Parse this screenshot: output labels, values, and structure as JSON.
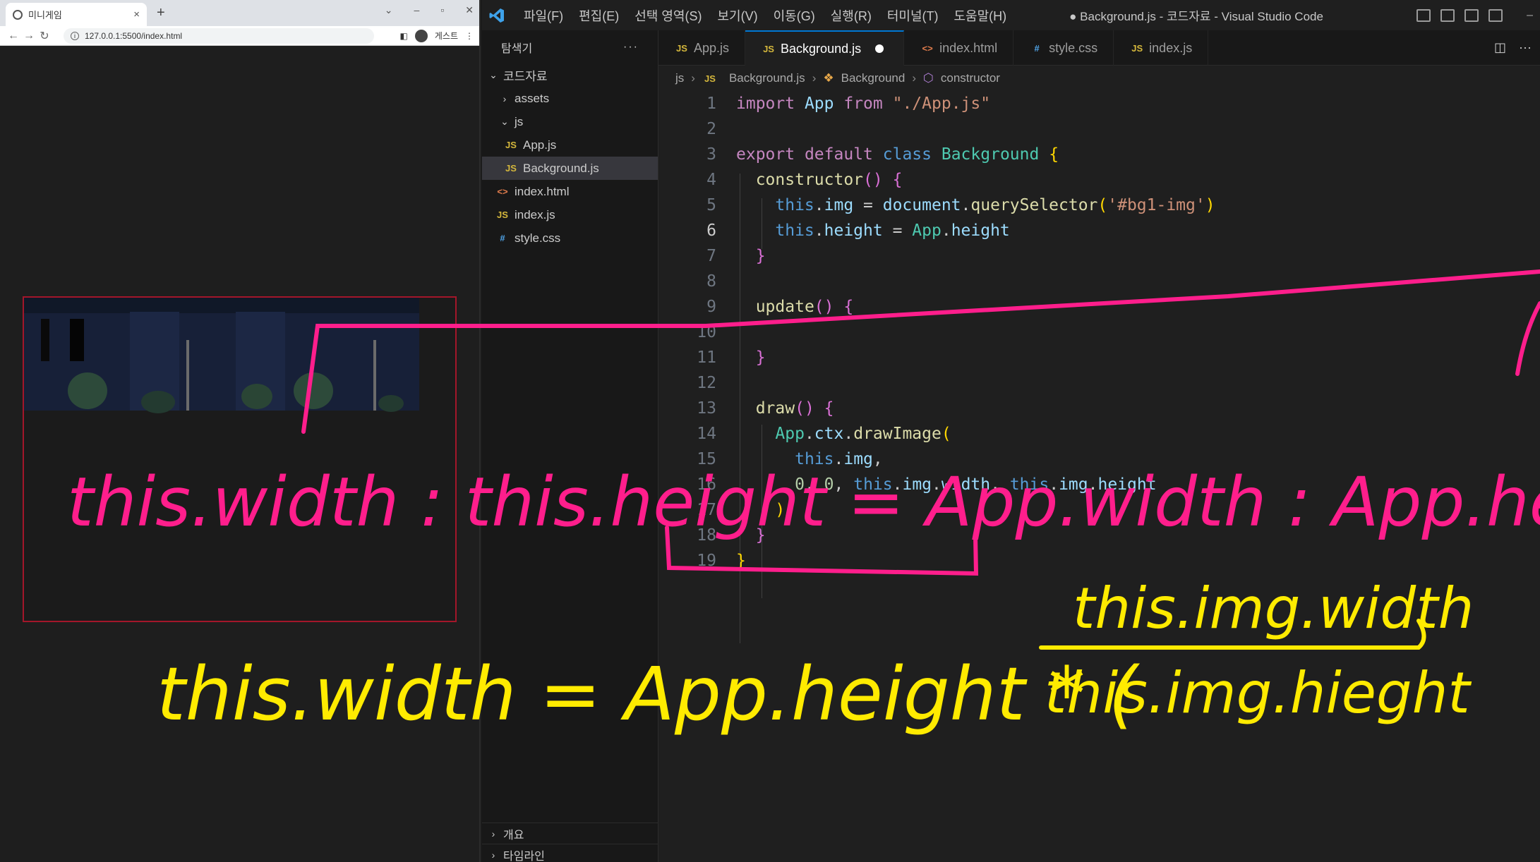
{
  "browser": {
    "tab_title": "미니게임",
    "url": "127.0.0.1:5500/index.html",
    "profile_label": "게스트"
  },
  "vscode": {
    "menu": [
      "파일(F)",
      "편집(E)",
      "선택 영역(S)",
      "보기(V)",
      "이동(G)",
      "실행(R)",
      "터미널(T)",
      "도움말(H)"
    ],
    "window_title": "● Background.js - 코드자료 - Visual Studio Code",
    "explorer": {
      "title": "탐색기",
      "more": "···",
      "root": "코드자료",
      "items": [
        {
          "label": "assets",
          "kind": "folder",
          "collapsed": true
        },
        {
          "label": "js",
          "kind": "folder",
          "collapsed": false
        },
        {
          "label": "App.js",
          "kind": "js"
        },
        {
          "label": "Background.js",
          "kind": "js",
          "selected": true
        },
        {
          "label": "index.html",
          "kind": "html"
        },
        {
          "label": "index.js",
          "kind": "js"
        },
        {
          "label": "style.css",
          "kind": "css"
        }
      ],
      "outline": "개요",
      "timeline": "타임라인"
    },
    "tabs": [
      {
        "label": "App.js",
        "icon": "JS"
      },
      {
        "label": "Background.js",
        "icon": "JS",
        "active": true,
        "modified": true
      },
      {
        "label": "index.html",
        "icon": "<>"
      },
      {
        "label": "style.css",
        "icon": "#"
      },
      {
        "label": "index.js",
        "icon": "JS"
      }
    ],
    "breadcrumb": [
      "js",
      "Background.js",
      "Background",
      "constructor"
    ],
    "line_numbers": [
      "1",
      "2",
      "3",
      "4",
      "5",
      "6",
      "7",
      "8",
      "9",
      "10",
      "11",
      "12",
      "13",
      "14",
      "15",
      "16",
      "17",
      "18",
      "19"
    ],
    "current_line": "6"
  },
  "annotations": {
    "pink_line1": "this.width : this.height = App.width : App.height",
    "yellow_line": "this.width = App.height * (",
    "yellow_fraction_top": "this.img.width",
    "yellow_fraction_bottom": "this.img.hieght",
    "pink_color": "#ff1e8c",
    "yellow_color": "#ffeb00"
  }
}
